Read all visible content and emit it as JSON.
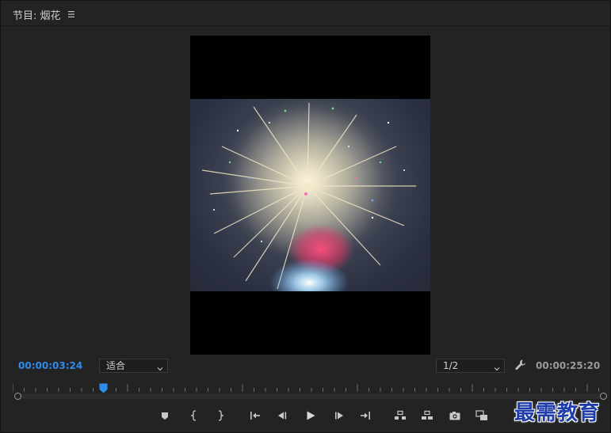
{
  "panel": {
    "title": "节目: 烟花",
    "menu_icon": "hamburger-menu-icon"
  },
  "timecodes": {
    "current": "00:00:03:24",
    "duration": "00:00:25:20"
  },
  "controls": {
    "zoom_value": "适合",
    "resolution_value": "1/2",
    "settings_icon": "wrench-icon"
  },
  "transport": {
    "buttons": [
      {
        "name": "add-marker-icon"
      },
      {
        "name": "mark-in-icon"
      },
      {
        "name": "mark-out-icon"
      },
      {
        "name": "go-to-in-icon"
      },
      {
        "name": "step-back-icon"
      },
      {
        "name": "play-icon"
      },
      {
        "name": "step-forward-icon"
      },
      {
        "name": "go-to-out-icon"
      },
      {
        "name": "lift-icon"
      },
      {
        "name": "extract-icon"
      },
      {
        "name": "export-frame-icon"
      },
      {
        "name": "compare-view-icon"
      }
    ]
  },
  "colors": {
    "accent": "#2d8ceb",
    "panel_bg": "#232323",
    "text_muted": "#9a9a9a"
  },
  "playhead": {
    "position_fraction": 0.153
  },
  "watermark": {
    "text": "最需教育"
  }
}
